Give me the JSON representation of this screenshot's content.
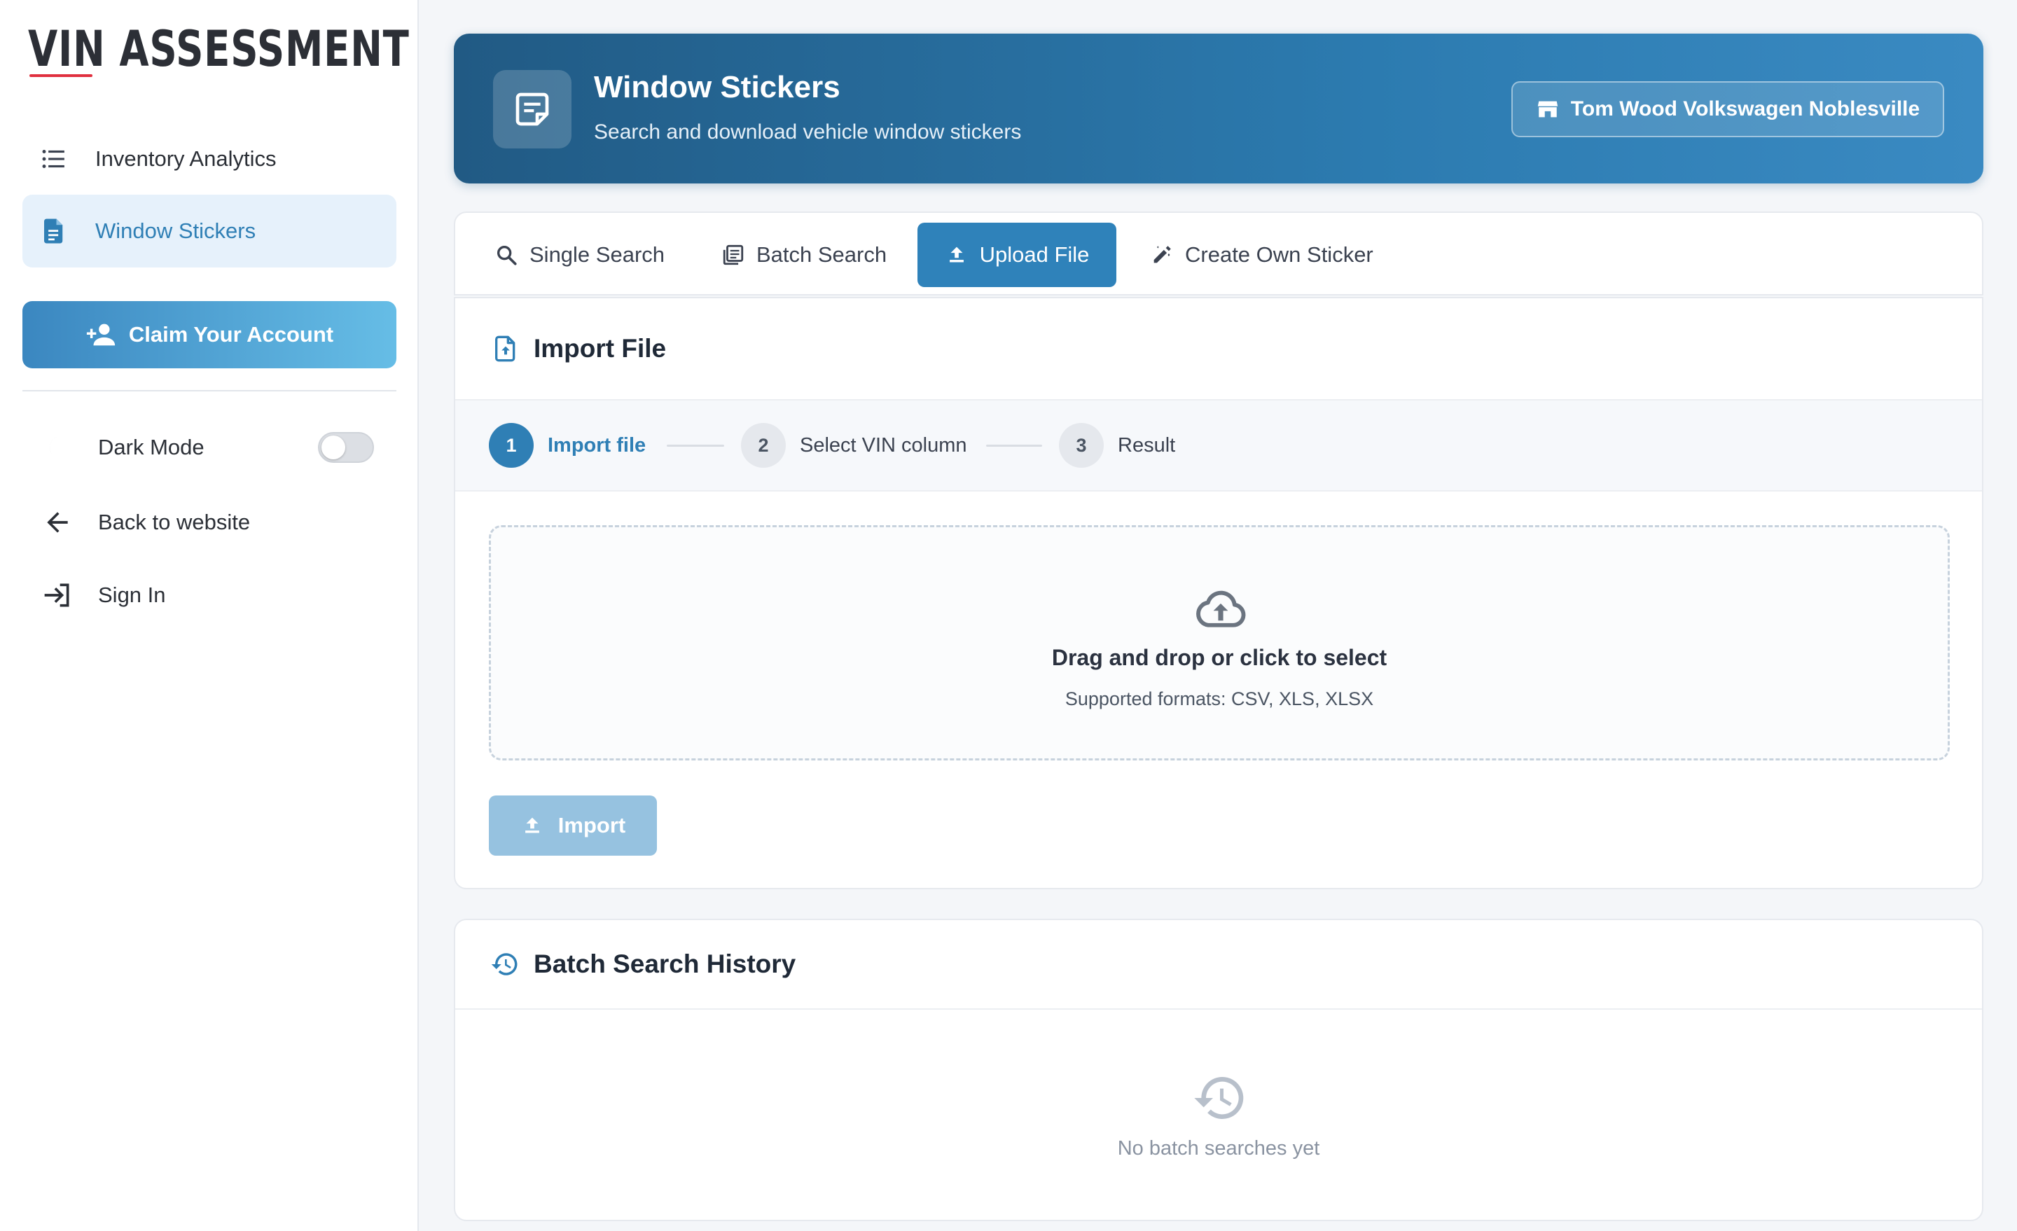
{
  "sidebar": {
    "logo": "VIN ASSESSMENT",
    "nav": [
      {
        "label": "Inventory Analytics",
        "icon": "list-icon"
      },
      {
        "label": "Window Stickers",
        "icon": "document-icon",
        "active": true
      }
    ],
    "claim_button": "Claim Your Account",
    "dark_mode_label": "Dark Mode",
    "dark_mode_on": false,
    "back_label": "Back to website",
    "sign_in_label": "Sign In"
  },
  "header": {
    "title": "Window Stickers",
    "subtitle": "Search and download vehicle window stickers",
    "dealer": "Tom Wood Volkswagen Noblesville"
  },
  "tabs": [
    {
      "label": "Single Search",
      "icon": "search-icon"
    },
    {
      "label": "Batch Search",
      "icon": "batch-icon"
    },
    {
      "label": "Upload File",
      "icon": "upload-icon",
      "active": true
    },
    {
      "label": "Create Own Sticker",
      "icon": "edit-icon"
    }
  ],
  "import": {
    "title": "Import File",
    "steps": [
      {
        "num": "1",
        "label": "Import file",
        "active": true
      },
      {
        "num": "2",
        "label": "Select VIN column"
      },
      {
        "num": "3",
        "label": "Result"
      }
    ],
    "dropzone_main": "Drag and drop or click to select",
    "dropzone_sub": "Supported formats: CSV, XLS, XLSX",
    "import_button": "Import"
  },
  "history": {
    "title": "Batch Search History",
    "empty_text": "No batch searches yet"
  },
  "colors": {
    "accent": "#2f7fb5",
    "banner_start": "#215a84",
    "banner_end": "#3a8ac2",
    "logo_underline": "#e0303f"
  }
}
